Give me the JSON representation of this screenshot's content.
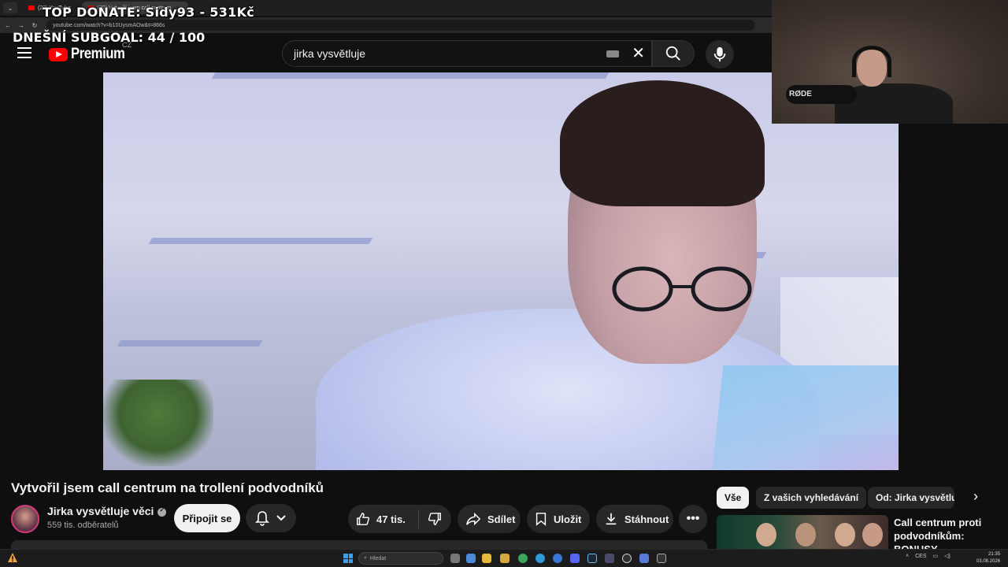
{
  "browser": {
    "tabs": [
      {
        "label": "(22) YouTube"
      },
      {
        "label": "(22) Vytvořil jsem call centrum"
      }
    ],
    "url": "youtube.com/watch?v=b10UysmAOw&t=866s"
  },
  "overlay": {
    "top_donate": "TOP DONATE: Sidy93 - 531Kč",
    "subgoal": "DNEŠNÍ SUBGOAL:  44 / 100"
  },
  "header": {
    "logo_text": "Premium",
    "country": "CZ",
    "search_value": "jirka vysvětluje"
  },
  "webcam": {
    "mic_brand": "RØDE"
  },
  "video": {
    "title": "Vytvořil jsem call centrum na trollení podvodníků"
  },
  "channel": {
    "name": "Jirka vysvětluje věci",
    "subscribers": "559 tis. odběratelů",
    "join_label": "Připojit se"
  },
  "actions": {
    "likes": "47 tis.",
    "share": "Sdílet",
    "save": "Uložit",
    "download": "Stáhnout"
  },
  "chips": [
    "Vše",
    "Z vašich vyhledávání",
    "Od: Jirka vysvětluje"
  ],
  "recommendation": {
    "title": "Call centrum proti podvodníkům: BONUSY"
  },
  "taskbar": {
    "search_placeholder": "Hledat",
    "tray_lang": "CES",
    "time": "21:35",
    "date": "03.08.2026"
  },
  "colors": {
    "brand_red": "#ff0000",
    "background": "#0f0f0f",
    "pill": "#272727"
  }
}
